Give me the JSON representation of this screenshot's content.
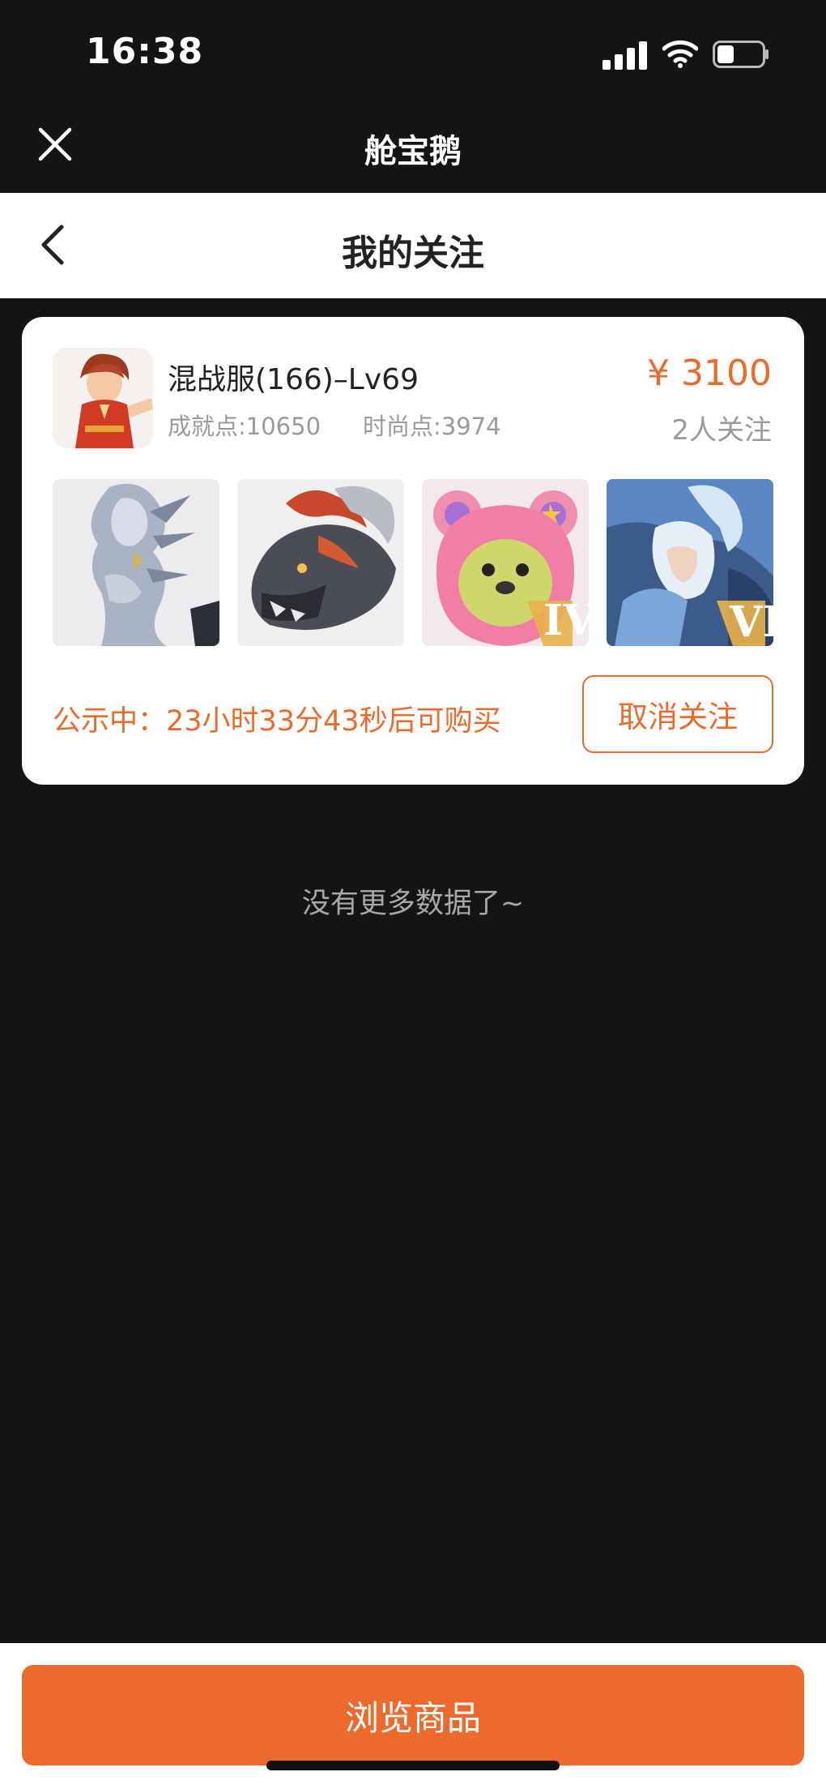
{
  "status_bar": {
    "time": "16:38"
  },
  "app_bar": {
    "title": "舱宝鹅"
  },
  "header": {
    "title": "我的关注"
  },
  "listing": {
    "title": "混战服(166)–Lv69",
    "achievement": "成就点:10650",
    "fashion": "时尚点:3974",
    "price": "¥ 3100",
    "followers": "2人关注",
    "thumbnails": [
      {
        "icon": "silver-dragon-icon"
      },
      {
        "icon": "dark-red-dragon-icon"
      },
      {
        "icon": "pink-bear-icon",
        "badge": "IV"
      },
      {
        "icon": "ice-dragon-rider-icon",
        "badge": "VI"
      }
    ],
    "countdown": "公示中：23小时33分43秒后可购买",
    "unfollow_label": "取消关注"
  },
  "empty_hint": "没有更多数据了~",
  "footer": {
    "browse_label": "浏览商品"
  },
  "colors": {
    "accent": "#ee6a2c",
    "background": "#141414",
    "card": "#ffffff"
  }
}
